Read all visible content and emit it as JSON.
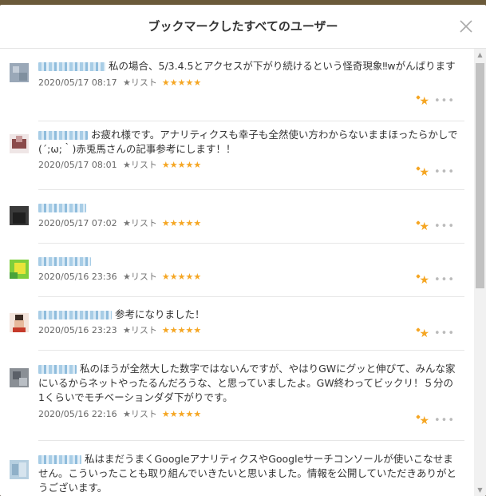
{
  "modal": {
    "title": "ブックマークしたすべてのユーザー"
  },
  "list_label": "★リスト",
  "rating": "★★★★★",
  "entries": [
    {
      "comment": "私の場合、5/3.4.5とアクセスが下がり続けるという怪奇現象‼wがんばります",
      "date": "2020/05/17 08:17"
    },
    {
      "comment": "お疲れ様です。アナリティクスも幸子も全然使い方わからないままほったらかしで(´;ω;｀)赤兎馬さんの記事参考にします！！",
      "date": "2020/05/17 08:01"
    },
    {
      "comment": "",
      "date": "2020/05/17 07:02"
    },
    {
      "comment": "",
      "date": "2020/05/16 23:36"
    },
    {
      "comment": "参考になりました！",
      "date": "2020/05/16 23:23"
    },
    {
      "comment": "私のほうが全然大した数字ではないんですが、やはりGWにグッと伸びて、みんな家にいるからネットやったるんだろうな、と思っていましたよ。GW終わってビックリ！５分の1くらいでモチベーションダダ下がりです。",
      "date": "2020/05/16 22:16"
    },
    {
      "comment": "私はまだうまくGoogleアナリティクスやGoogleサーチコンソールが使いこなせません。こういったことも取り組んでいきたいと思いました。情報を公開していただきありがとうございます。",
      "date": ""
    }
  ],
  "icons": {
    "close": "close-icon",
    "favorite": "star-icon",
    "more": "more-dots-icon"
  },
  "colors": {
    "star": "#f5a623",
    "separator": "#e6e6e6"
  }
}
